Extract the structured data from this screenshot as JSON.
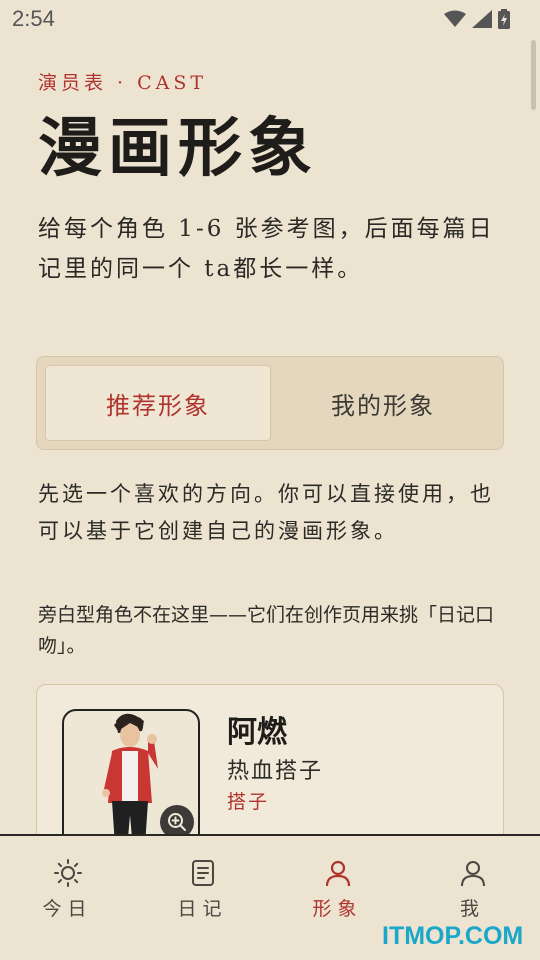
{
  "status_bar": {
    "time": "2:54",
    "icons": [
      "wifi-icon",
      "signal-icon",
      "battery-charging-icon"
    ]
  },
  "header": {
    "eyebrow": "演员表 · CAST",
    "title": "漫画形象",
    "intro": "给每个角色 1-6 张参考图，后面每篇日记里的同一个 ta都长一样。"
  },
  "tabs": [
    {
      "label": "推荐形象",
      "active": true
    },
    {
      "label": "我的形象",
      "active": false
    }
  ],
  "guide_text": "先选一个喜欢的方向。你可以直接使用，也可以基于它创建自己的漫画形象。",
  "note_text": "旁白型角色不在这里——它们在创作页用来挑「日记口吻」。",
  "character_card": {
    "name": "阿燃",
    "description": "热血搭子",
    "tag": "搭子",
    "zoom_icon": "zoom-in-icon"
  },
  "bottom_nav": [
    {
      "label": "今日",
      "icon": "sun-icon",
      "active": false
    },
    {
      "label": "日记",
      "icon": "notebook-icon",
      "active": false
    },
    {
      "label": "形象",
      "icon": "person-icon",
      "active": true
    },
    {
      "label": "我",
      "icon": "user-icon",
      "active": false
    }
  ],
  "watermark": "ITMOP.COM",
  "colors": {
    "background": "#ece3d1",
    "accent": "#b0342e",
    "card": "#f1e9d9",
    "border": "#d5c6a8"
  }
}
